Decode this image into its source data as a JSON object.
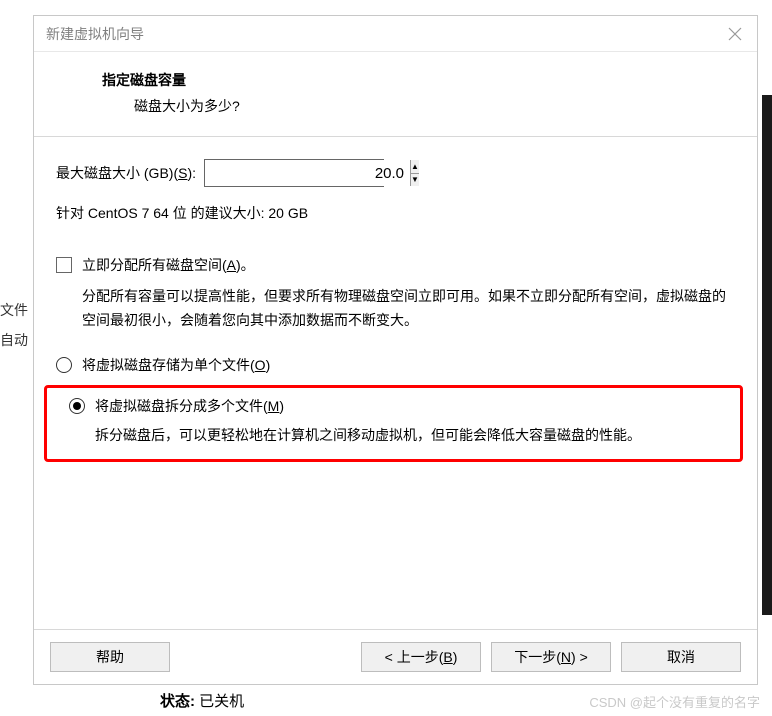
{
  "background": {
    "leftText1": "文件",
    "leftText2": "自动"
  },
  "dialog": {
    "title": "新建虚拟机向导",
    "header": {
      "title": "指定磁盘容量",
      "subtitle": "磁盘大小为多少?"
    },
    "sizeRow": {
      "label_pre": "最大磁盘大小 (GB)(",
      "label_key": "S",
      "label_post": "):",
      "value": "20.0"
    },
    "recommend": "针对 CentOS 7 64 位 的建议大小: 20 GB",
    "checkbox": {
      "label_pre": "立即分配所有磁盘空间(",
      "label_key": "A",
      "label_post": ")。",
      "desc": "分配所有容量可以提高性能，但要求所有物理磁盘空间立即可用。如果不立即分配所有空间，虚拟磁盘的空间最初很小，会随着您向其中添加数据而不断变大。"
    },
    "radio1": {
      "label_pre": "将虚拟磁盘存储为单个文件(",
      "label_key": "O",
      "label_post": ")"
    },
    "radio2": {
      "label_pre": "将虚拟磁盘拆分成多个文件(",
      "label_key": "M",
      "label_post": ")",
      "desc": "拆分磁盘后，可以更轻松地在计算机之间移动虚拟机，但可能会降低大容量磁盘的性能。"
    },
    "buttons": {
      "help": "帮助",
      "back_pre": "< 上一步(",
      "back_key": "B",
      "back_post": ")",
      "next_pre": "下一步(",
      "next_key": "N",
      "next_post": ") >",
      "cancel": "取消"
    }
  },
  "status": {
    "label": "状态:",
    "value": " 已关机"
  },
  "watermark": "CSDN @起个没有重复的名字"
}
